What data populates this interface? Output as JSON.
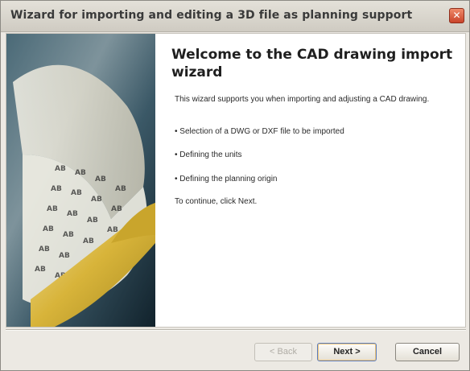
{
  "window": {
    "title": "Wizard for importing and editing a 3D file as planning support",
    "close_glyph": "✕"
  },
  "content": {
    "heading": "Welcome to the CAD drawing import wizard",
    "intro": "This wizard supports you when importing and adjusting a CAD drawing.",
    "bullets": [
      "• Selection of a DWG or DXF file to be imported",
      "• Defining the units",
      "• Defining the planning origin"
    ],
    "outro": "To continue, click Next."
  },
  "buttons": {
    "back": "< Back",
    "next": "Next >",
    "cancel": "Cancel"
  },
  "colors": {
    "title_bar": "#d6d2c9",
    "close": "#d9533a",
    "image_dark": "#1b3a4a",
    "paper": "#d8b83a"
  }
}
